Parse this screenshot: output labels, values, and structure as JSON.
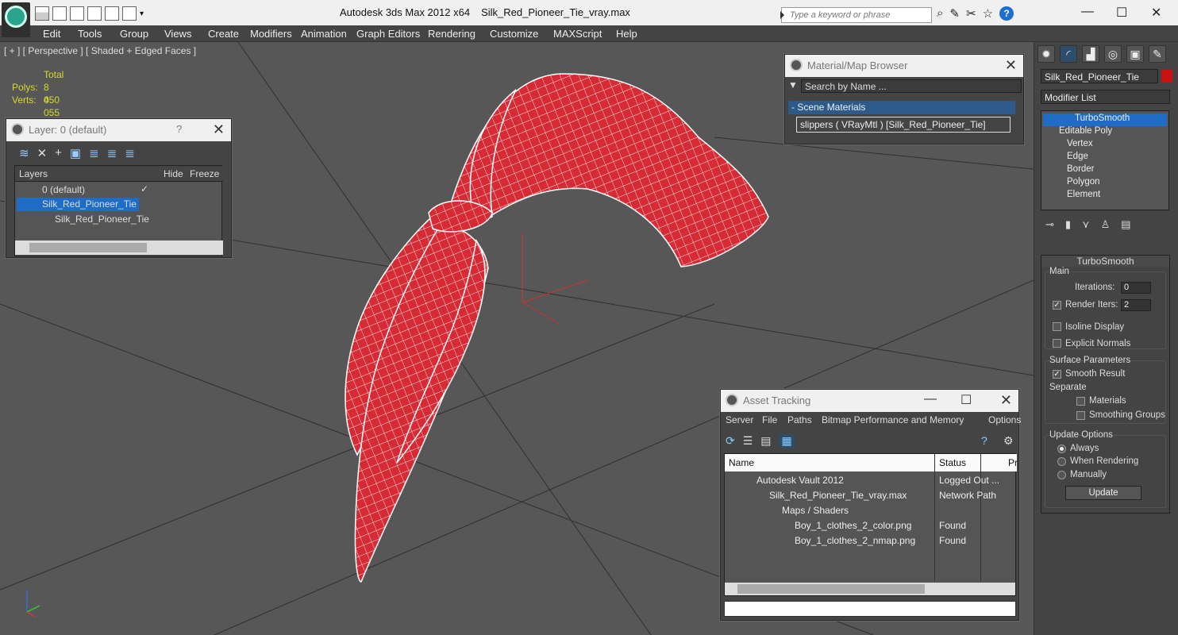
{
  "window": {
    "app": "Autodesk 3ds Max  2012 x64",
    "file": "Silk_Red_Pioneer_Tie_vray.max",
    "search_placeholder": "Type a keyword or phrase"
  },
  "menu": [
    "Edit",
    "Tools",
    "Group",
    "Views",
    "Create",
    "Modifiers",
    "Animation",
    "Graph Editors",
    "Rendering",
    "Customize",
    "MAXScript",
    "Help"
  ],
  "viewport": {
    "label": "[ + ] [ Perspective ] [ Shaded + Edged Faces ]",
    "stats": {
      "total": "Total",
      "polys_label": "Polys:",
      "polys": "8 050",
      "verts_label": "Verts:",
      "verts": "4 055"
    }
  },
  "layer_panel": {
    "title": "Layer: 0 (default)",
    "help": "?",
    "col_layers": "Layers",
    "col_hide": "Hide",
    "col_freeze": "Freeze",
    "rows": [
      "0 (default)",
      "Silk_Red_Pioneer_Tie",
      "Silk_Red_Pioneer_Tie"
    ]
  },
  "material_browser": {
    "title": "Material/Map Browser",
    "search": "Search by Name ...",
    "group": "- Scene Materials",
    "item": "slippers  ( VRayMtl ) [Silk_Red_Pioneer_Tie]"
  },
  "asset_tracking": {
    "title": "Asset Tracking",
    "menu": [
      "Server",
      "File",
      "Paths",
      "Bitmap Performance and Memory",
      "Options"
    ],
    "col_name": "Name",
    "col_status": "Status",
    "col_pr": "Pr",
    "rows": [
      {
        "name": "Autodesk Vault 2012",
        "status": "Logged Out ..."
      },
      {
        "name": "Silk_Red_Pioneer_Tie_vray.max",
        "status": "Network Path"
      },
      {
        "name": "Maps / Shaders",
        "status": ""
      },
      {
        "name": "Boy_1_clothes_2_color.png",
        "status": "Found"
      },
      {
        "name": "Boy_1_clothes_2_nmap.png",
        "status": "Found"
      }
    ]
  },
  "command_panel": {
    "object_name": "Silk_Red_Pioneer_Tie",
    "object_color": "#cc1111",
    "modifier_list": "Modifier List",
    "stack": [
      "TurboSmooth",
      "Editable Poly",
      "Vertex",
      "Edge",
      "Border",
      "Polygon",
      "Element"
    ],
    "turbosmooth": {
      "title": "TurboSmooth",
      "main": "Main",
      "iterations_label": "Iterations:",
      "iterations": "0",
      "render_iters_label": "Render Iters:",
      "render_iters": "2",
      "isoline": "Isoline Display",
      "explicit": "Explicit Normals",
      "surface": "Surface Parameters",
      "smooth_result": "Smooth Result",
      "separate": "Separate",
      "materials": "Materials",
      "smoothing_groups": "Smoothing Groups",
      "update_options": "Update Options",
      "always": "Always",
      "when_rendering": "When Rendering",
      "manually": "Manually",
      "update": "Update"
    }
  },
  "colors": {
    "accent": "#1e6cc6",
    "tie_red": "#d62a35",
    "viewport_bg": "#575757"
  }
}
